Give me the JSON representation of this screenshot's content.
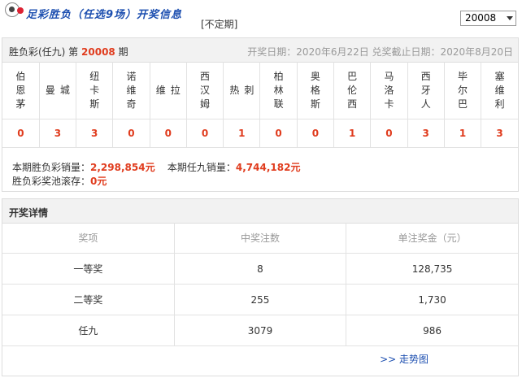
{
  "header": {
    "logo_text": "足彩胜负（任选9场）开奖信息",
    "irregular_note": "[不定期]",
    "issue_selected": "20008"
  },
  "draw": {
    "title_prefix": "胜负彩(任九) 第",
    "issue": "20008",
    "title_suffix": "期",
    "draw_date_text": "开奖日期：2020年6月22日 兑奖截止日期：2020年8月20日"
  },
  "matches": [
    {
      "team": "伯恩茅",
      "result": "0"
    },
    {
      "team": "曼城",
      "result": "3"
    },
    {
      "team": "纽卡斯",
      "result": "3"
    },
    {
      "team": "诺维奇",
      "result": "0"
    },
    {
      "team": "维拉",
      "result": "0"
    },
    {
      "team": "西汉姆",
      "result": "0"
    },
    {
      "team": "热刺",
      "result": "1"
    },
    {
      "team": "柏林联",
      "result": "0"
    },
    {
      "team": "奥格斯",
      "result": "0"
    },
    {
      "team": "巴伦西",
      "result": "1"
    },
    {
      "team": "马洛卡",
      "result": "0"
    },
    {
      "team": "西牙人",
      "result": "3"
    },
    {
      "team": "毕尔巴",
      "result": "1"
    },
    {
      "team": "塞维利",
      "result": "3"
    }
  ],
  "sales": {
    "sfc_label": "本期胜负彩销量：",
    "sfc_value": "2,298,854元",
    "r9_label": "本期任九销量：",
    "r9_value": "4,744,182元",
    "pool_label": "胜负彩奖池滚存：",
    "pool_value": "0元"
  },
  "prize_section": {
    "title": "开奖详情",
    "columns": [
      "奖项",
      "中奖注数",
      "单注奖金（元）"
    ],
    "rows": [
      [
        "一等奖",
        "8",
        "128,735"
      ],
      [
        "二等奖",
        "255",
        "1,730"
      ],
      [
        "任九",
        "3079",
        "986"
      ]
    ],
    "trend_link": ">> 走势图"
  },
  "colors": {
    "accent": "#e03c1e",
    "link": "#1d4fb0"
  }
}
